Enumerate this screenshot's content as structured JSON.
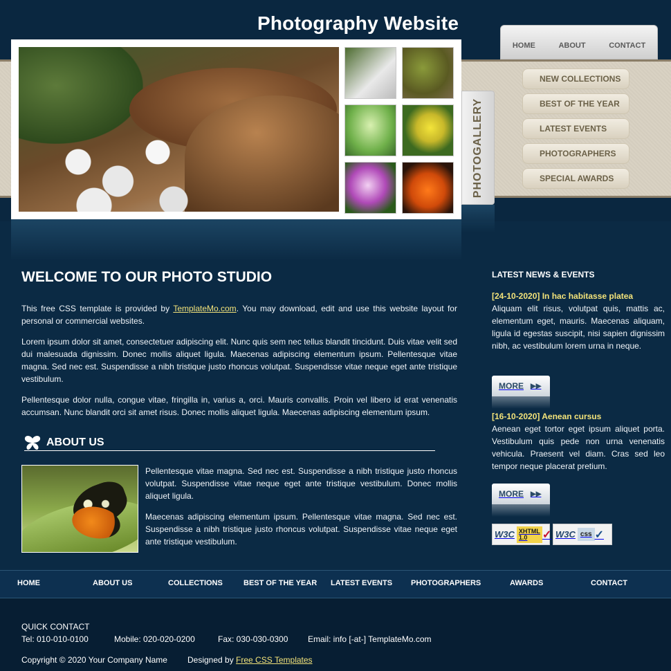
{
  "header": {
    "title": "Photography Website",
    "top_nav": [
      "HOME",
      "ABOUT",
      "CONTACT"
    ]
  },
  "gallery": {
    "tab_label": "PHOTOGALLERY",
    "side_menu": [
      "NEW COLLECTIONS",
      "BEST OF THE YEAR",
      "LATEST EVENTS",
      "PHOTOGRAPHERS",
      "SPECIAL AWARDS"
    ]
  },
  "main": {
    "welcome_heading": "WELCOME TO OUR PHOTO STUDIO",
    "intro_before": "This free CSS template is provided by ",
    "intro_link": "TemplateMo.com",
    "intro_after": ". You may download, edit and use this website layout for personal or commercial websites.",
    "para2": "Lorem ipsum dolor sit amet, consectetuer adipiscing elit. Nunc quis sem nec tellus blandit tincidunt. Duis vitae velit sed dui malesuada dignissim. Donec mollis aliquet ligula. Maecenas adipiscing elementum ipsum. Pellentesque vitae magna. Sed nec est. Suspendisse a nibh tristique justo rhoncus volutpat. Suspendisse vitae neque eget ante tristique vestibulum.",
    "para3": "Pellentesque dolor nulla, congue vitae, fringilla in, varius a, orci. Mauris convallis. Proin vel libero id erat venenatis accumsan. Nunc blandit orci sit amet risus. Donec mollis aliquet ligula. Maecenas adipiscing elementum ipsum.",
    "about_heading": "ABOUT US",
    "about_p1": "Pellentesque vitae magna. Sed nec est. Suspendisse a nibh tristique justo rhoncus volutpat. Suspendisse vitae neque eget ante tristique vestibulum. Donec mollis aliquet ligula.",
    "about_p2": "Maecenas adipiscing elementum ipsum. Pellentesque vitae magna. Sed nec est. Suspendisse a nibh tristique justo rhoncus volutpat. Suspendisse vitae neque eget ante tristique vestibulum."
  },
  "news": {
    "heading": "LATEST NEWS & EVENTS",
    "items": [
      {
        "title": "[24-10-2020] In hac habitasse platea",
        "body": "Aliquam elit risus, volutpat quis, mattis ac, elementum eget, mauris. Maecenas aliquam, ligula id egestas suscipit, nisi sapien dignissim nibh, ac vestibulum lorem urna in neque.",
        "more": "MORE"
      },
      {
        "title": "[16-10-2020] Aenean cursus",
        "body": "Aenean eget tortor eget ipsum aliquet porta. Vestibulum quis pede non urna venenatis vehicula. Praesent vel diam. Cras sed leo tempor neque placerat pretium.",
        "more": "MORE"
      }
    ],
    "badges": {
      "w3c": "W3C",
      "xhtml": "XHTML",
      "xhtml_ver": "1.0",
      "css": "css"
    }
  },
  "bottom_nav": [
    "HOME",
    "ABOUT US",
    "COLLECTIONS",
    "BEST OF THE YEAR",
    "LATEST EVENTS",
    "PHOTOGRAPHERS",
    "AWARDS",
    "CONTACT"
  ],
  "footer": {
    "quick_contact": "QUICK CONTACT",
    "tel": "Tel: 010-010-0100",
    "mobile": "Mobile: 020-020-0200",
    "fax": "Fax: 030-030-0300",
    "email": "Email: info [-at-] TemplateMo.com",
    "copyright": "Copyright © 2020 Your Company Name",
    "designed_by": "Designed by ",
    "designed_link": "Free CSS Templates"
  }
}
